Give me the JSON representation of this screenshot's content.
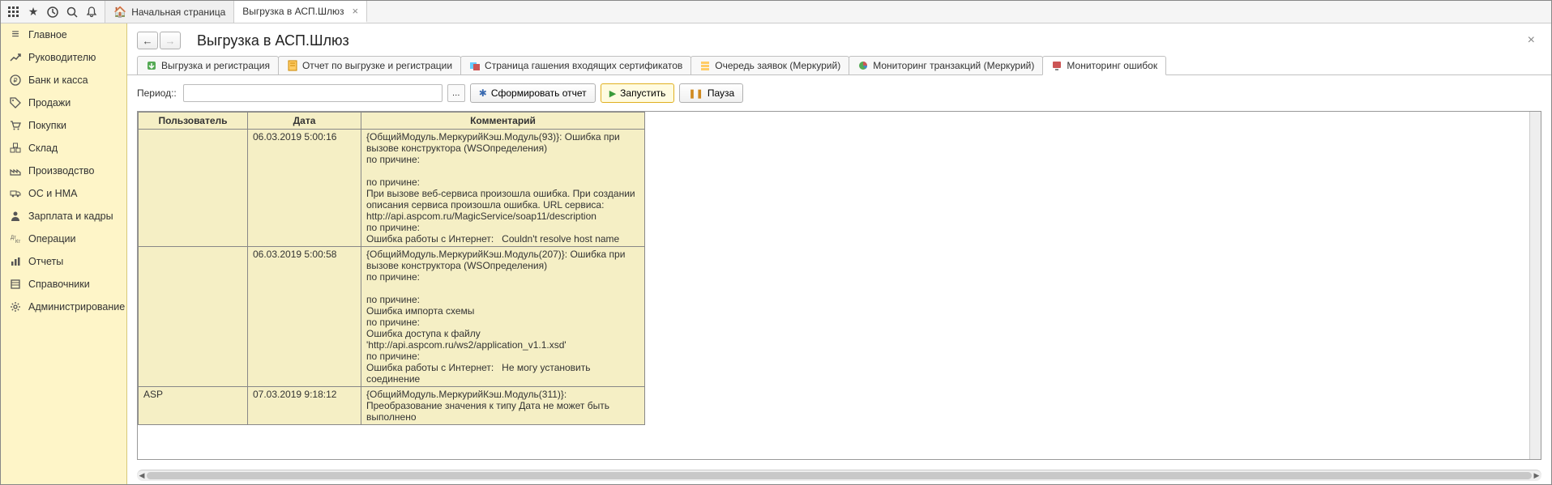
{
  "toolbar": {
    "home_tab": "Начальная страница",
    "active_tab": "Выгрузка в АСП.Шлюз"
  },
  "sidebar": {
    "items": [
      {
        "label": "Главное"
      },
      {
        "label": "Руководителю"
      },
      {
        "label": "Банк и касса"
      },
      {
        "label": "Продажи"
      },
      {
        "label": "Покупки"
      },
      {
        "label": "Склад"
      },
      {
        "label": "Производство"
      },
      {
        "label": "ОС и НМА"
      },
      {
        "label": "Зарплата и кадры"
      },
      {
        "label": "Операции"
      },
      {
        "label": "Отчеты"
      },
      {
        "label": "Справочники"
      },
      {
        "label": "Администрирование"
      }
    ]
  },
  "page": {
    "title": "Выгрузка в АСП.Шлюз"
  },
  "tabs": [
    {
      "label": "Выгрузка и регистрация"
    },
    {
      "label": "Отчет по выгрузке и регистрации"
    },
    {
      "label": "Страница гашения входящих сертификатов"
    },
    {
      "label": "Очередь заявок (Меркурий)"
    },
    {
      "label": "Мониторинг транзакций (Меркурий)"
    },
    {
      "label": "Мониторинг ошибок"
    }
  ],
  "controls": {
    "period_label": "Период::",
    "period_value": "",
    "form_report": "Сформировать отчет",
    "run": "Запустить",
    "pause": "Пауза"
  },
  "table": {
    "headers": {
      "user": "Пользователь",
      "date": "Дата",
      "comment": "Комментарий"
    },
    "rows": [
      {
        "user": "",
        "date": "06.03.2019 5:00:16",
        "comment": "{ОбщийМодуль.МеркурийКэш.Модуль(93)}: Ошибка при вызове конструктора (WSОпределения)\nпо причине:\n\nпо причине:\nПри вызове веб-сервиса произошла ошибка. При создании описания сервиса произошла ошибка. URL сервиса:\nhttp://api.aspcom.ru/MagicService/soap11/description\nпо причине:\nОшибка работы с Интернет:   Couldn't resolve host name"
      },
      {
        "user": "",
        "date": "06.03.2019 5:00:58",
        "comment": "{ОбщийМодуль.МеркурийКэш.Модуль(207)}: Ошибка при вызове конструктора (WSОпределения)\nпо причине:\n\nпо причине:\nОшибка импорта схемы\nпо причине:\nОшибка доступа к файлу\n'http://api.aspcom.ru/ws2/application_v1.1.xsd'\nпо причине:\nОшибка работы с Интернет:   Не могу установить соединение"
      },
      {
        "user": "ASP",
        "date": "07.03.2019 9:18:12",
        "comment": "{ОбщийМодуль.МеркурийКэш.Модуль(311)}: Преобразование значения к типу Дата не может быть выполнено"
      }
    ]
  }
}
